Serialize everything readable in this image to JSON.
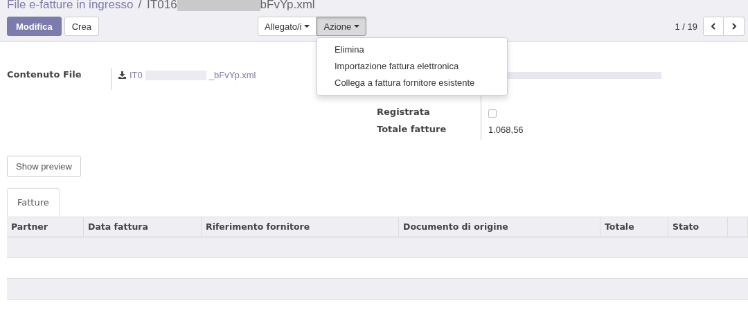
{
  "breadcrumb": {
    "parent": "File e-fatture in ingresso",
    "separator": "/",
    "record_start": "IT016",
    "record_end": "bFvYp.xml"
  },
  "buttons": [
    {
      "label": "Modifica",
      "kind": "primary"
    },
    {
      "label": "Crea",
      "kind": "secondary"
    }
  ],
  "sidebar_buttons": [
    {
      "label": "Allegato/i",
      "selected": false
    },
    {
      "label": "Azione",
      "selected": true
    }
  ],
  "action_menu": [
    "Elimina",
    "Importazione fattura elettronica",
    "Collega a fattura fornitore esistente"
  ],
  "pager": {
    "value": "1 / 19"
  },
  "left_fields": [
    {
      "label": "Contenuto File",
      "start": "IT0",
      "end": "_bFvYp.xml"
    }
  ],
  "right_fields": [
    {
      "label": "Registrata",
      "kind": "checkbox",
      "checked": false
    },
    {
      "label": "Totale fatture",
      "kind": "text",
      "value": "1.068,56"
    }
  ],
  "preview_button": "Show preview",
  "tabs": [
    {
      "label": "Fatture",
      "selected": true
    }
  ],
  "table": {
    "columns": [
      "Partner",
      "Data fattura",
      "Riferimento fornitore",
      "Documento di origine",
      "Totale",
      "Stato"
    ]
  }
}
